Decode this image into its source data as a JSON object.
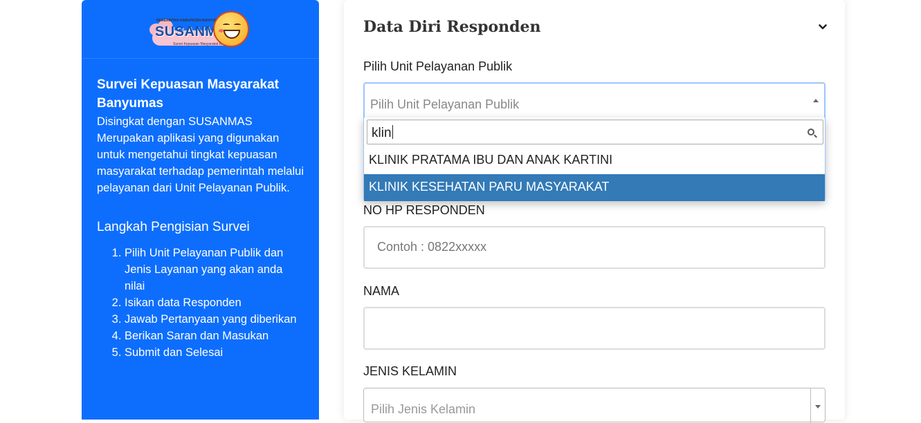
{
  "sidebar": {
    "logo_text": "SUSANMAS",
    "logo_topline": "PEMERINTAH KABUPATEN BANYUMAS",
    "logo_subline": "Survei Kepuasan Masyarakat Banyumas",
    "title": "Survei Kepuasan Masyarakat Banyumas",
    "description": "Disingkat dengan SUSANMAS Merupakan aplikasi yang digunakan untuk mengetahui tingkat kepuasan masyarakat terhadap pemerintah melalui pelayanan dari Unit Pelayanan Publik.",
    "steps_title": "Langkah Pengisian Survei",
    "steps": [
      "Pilih Unit Pelayanan Publik dan Jenis Layanan yang akan anda nilai",
      "Isikan data Responden",
      "Jawab Pertanyaan yang diberikan",
      "Berikan Saran dan Masukan",
      "Submit dan Selesai"
    ]
  },
  "form": {
    "title": "Data Diri Responden",
    "unit_label": "Pilih Unit Pelayanan Publik",
    "unit_placeholder": "Pilih Unit Pelayanan Publik",
    "search_value": "klin",
    "options": [
      "KLINIK PRATAMA IBU DAN ANAK KARTINI",
      "KLINIK KESEHATAN PARU MASYARAKAT"
    ],
    "highlighted_option_index": 1,
    "phone_label": "NO HP RESPONDEN",
    "phone_placeholder": "Contoh : 0822xxxxx",
    "name_label": "NAMA",
    "name_value": "",
    "gender_label": "JENIS KELAMIN",
    "gender_placeholder": "Pilih Jenis Kelamin"
  },
  "colors": {
    "sidebar_bg": "#0d6efd",
    "highlight": "#337ab7"
  },
  "icons": {
    "collapse": "chevron-down-icon",
    "search": "search-icon"
  }
}
